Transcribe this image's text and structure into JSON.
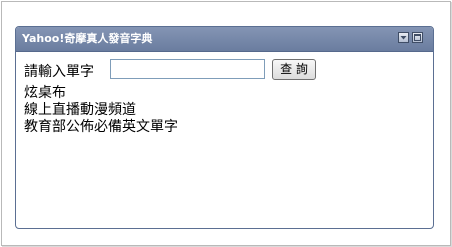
{
  "widget": {
    "title": "Yahoo!奇摩真人發音字典"
  },
  "search": {
    "label": "請輸入單字",
    "input_value": "",
    "placeholder": "",
    "button_label": "查 詢"
  },
  "links": [
    {
      "label": "炫桌布"
    },
    {
      "label": "線上直播動漫頻道"
    },
    {
      "label": "教育部公佈必備英文單字"
    }
  ],
  "colors": {
    "titlebar": "#7486a8",
    "title_text": "#ffffff",
    "widget_border": "#5b6f92"
  },
  "icons": {
    "dropdown": "dropdown-icon",
    "maximize": "maximize-icon"
  }
}
